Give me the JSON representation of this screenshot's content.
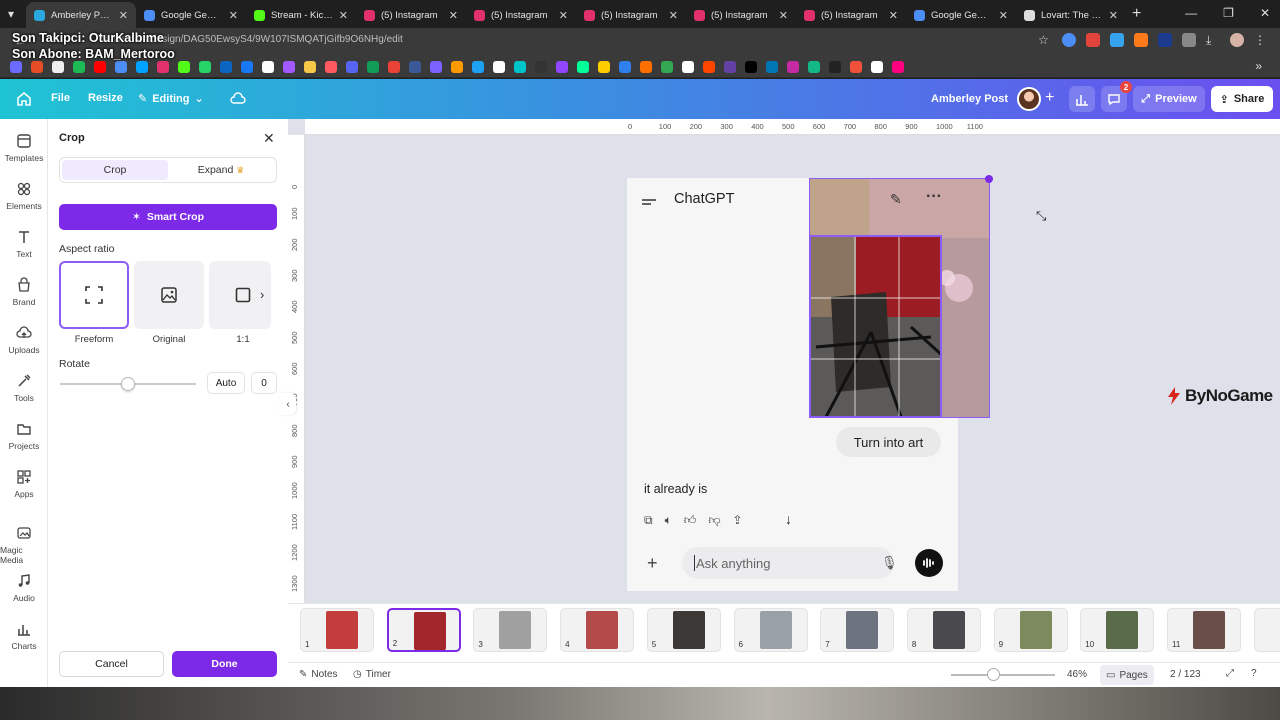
{
  "overlay": {
    "line1": "Son Takipci: OturKalbime",
    "line2": "Son Abone: BAM_Mertoroo"
  },
  "browser": {
    "tabs": [
      {
        "title": "Amberley Post - ",
        "color": "#2ba8e0",
        "active": true
      },
      {
        "title": "Google Gemini",
        "color": "#4c8df6"
      },
      {
        "title": "Stream - Kick Da",
        "color": "#53fc18"
      },
      {
        "title": "(5) Instagram",
        "color": "#e1306c"
      },
      {
        "title": "(5) Instagram",
        "color": "#e1306c"
      },
      {
        "title": "(5) Instagram",
        "color": "#e1306c"
      },
      {
        "title": "(5) Instagram",
        "color": "#e1306c"
      },
      {
        "title": "(5) Instagram",
        "color": "#e1306c"
      },
      {
        "title": "Google Gemini",
        "color": "#4c8df6"
      },
      {
        "title": "Lovart: The Worl",
        "color": "#dddddd"
      }
    ],
    "url": "canva.com/design/DAG50EwsyS4/9W107ISMQATjGifb9O6NHg/edit"
  },
  "header": {
    "file": "File",
    "resize": "Resize",
    "editing": "Editing",
    "project_title": "Amberley Post",
    "comment_badge": "2",
    "preview": "Preview",
    "share": "Share"
  },
  "rail": [
    {
      "label": "Templates",
      "icon": "templates-icon"
    },
    {
      "label": "Elements",
      "icon": "elements-icon"
    },
    {
      "label": "Text",
      "icon": "text-icon"
    },
    {
      "label": "Brand",
      "icon": "brand-icon"
    },
    {
      "label": "Uploads",
      "icon": "uploads-icon"
    },
    {
      "label": "Tools",
      "icon": "tools-icon"
    },
    {
      "label": "Projects",
      "icon": "projects-icon"
    },
    {
      "label": "Apps",
      "icon": "apps-icon"
    },
    {
      "label": "Magic Media",
      "icon": "magic-media-icon"
    },
    {
      "label": "Audio",
      "icon": "audio-icon"
    },
    {
      "label": "Charts",
      "icon": "charts-icon"
    }
  ],
  "crop_panel": {
    "title": "Crop",
    "tab_crop": "Crop",
    "tab_expand": "Expand",
    "smart_crop": "Smart Crop",
    "aspect_ratio_label": "Aspect ratio",
    "ratios": [
      {
        "label": "Freeform",
        "selected": true
      },
      {
        "label": "Original"
      },
      {
        "label": "1:1"
      }
    ],
    "rotate_label": "Rotate",
    "rotate_auto": "Auto",
    "rotate_value": "0",
    "rotate_level": 0.5,
    "cancel": "Cancel",
    "done": "Done"
  },
  "rulers": {
    "top": [
      "0",
      "100",
      "200",
      "300",
      "400",
      "500",
      "600",
      "700",
      "800",
      "900",
      "1000",
      "1100"
    ],
    "left": [
      "0",
      "100",
      "200",
      "300",
      "400",
      "500",
      "600",
      "700",
      "800",
      "900",
      "1000",
      "1100",
      "1200",
      "1300"
    ]
  },
  "design": {
    "app_title": "ChatGPT",
    "user_message": "Turn into art",
    "assistant_reply": "it already is",
    "composer_placeholder": "Ask anything",
    "watermark": "ByNoGame"
  },
  "pages": [
    {
      "num": "1",
      "color": "#c43d3d"
    },
    {
      "num": "2",
      "color": "#a3262c",
      "current": true
    },
    {
      "num": "3",
      "color": "#a0a0a0"
    },
    {
      "num": "4",
      "color": "#b44a4a"
    },
    {
      "num": "5",
      "color": "#3b3835"
    },
    {
      "num": "6",
      "color": "#9aa0a8"
    },
    {
      "num": "7",
      "color": "#6d7480"
    },
    {
      "num": "8",
      "color": "#4a4a4e"
    },
    {
      "num": "9",
      "color": "#7c8a5e"
    },
    {
      "num": "10",
      "color": "#5a6b4a"
    },
    {
      "num": "11",
      "color": "#6a4e4a"
    }
  ],
  "footer": {
    "notes": "Notes",
    "timer": "Timer",
    "zoom": "46%",
    "zoom_level": 0.46,
    "pages": "Pages",
    "page_count": "2 / 123"
  }
}
